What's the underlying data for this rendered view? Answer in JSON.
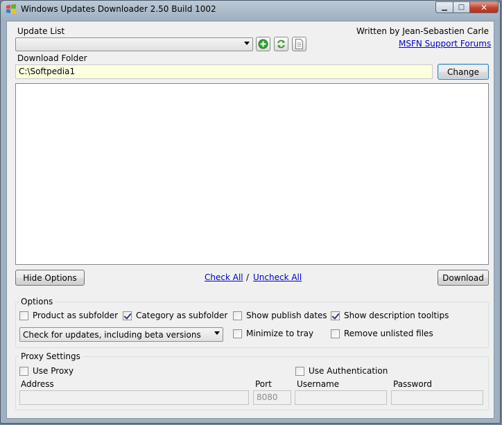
{
  "window": {
    "title": "Windows Updates Downloader 2.50 Build 1002",
    "controls": {
      "minimize": "▁",
      "maximize": "□",
      "close": "✕"
    }
  },
  "header": {
    "update_list_label": "Update List",
    "update_list_value": "",
    "author": "Written by Jean-Sebastien Carle",
    "support_link": "MSFN Support Forums",
    "icons": [
      "add-icon",
      "refresh-icon",
      "document-icon"
    ]
  },
  "download": {
    "folder_label": "Download Folder",
    "folder_value": "C:\\Softpedia1",
    "change_label": "Change"
  },
  "updates_list": {
    "items": []
  },
  "actions": {
    "hide_options": "Hide Options",
    "check_all": "Check All",
    "separator": "/",
    "uncheck_all": "Uncheck All",
    "download": "Download"
  },
  "options": {
    "title": "Options",
    "product_subfolder": {
      "label": "Product as subfolder",
      "checked": false
    },
    "category_subfolder": {
      "label": "Category as subfolder",
      "checked": true
    },
    "show_publish_dates": {
      "label": "Show publish dates",
      "checked": false
    },
    "show_tooltips": {
      "label": "Show description tooltips",
      "checked": true
    },
    "update_mode": "Check for updates, including beta versions",
    "minimize_tray": {
      "label": "Minimize to tray",
      "checked": false
    },
    "remove_unlisted": {
      "label": "Remove unlisted files",
      "checked": false
    }
  },
  "proxy": {
    "title": "Proxy Settings",
    "use_proxy": {
      "label": "Use Proxy",
      "checked": false
    },
    "use_auth": {
      "label": "Use Authentication",
      "checked": false
    },
    "address_label": "Address",
    "address_value": "",
    "port_label": "Port",
    "port_value": "8080",
    "username_label": "Username",
    "username_value": "",
    "password_label": "Password",
    "password_value": ""
  },
  "colors": {
    "link": "#0000cc",
    "folder_bg": "#ffffe1",
    "add_icon": "#2fa52f",
    "refresh_icon": "#3f9a2f"
  }
}
